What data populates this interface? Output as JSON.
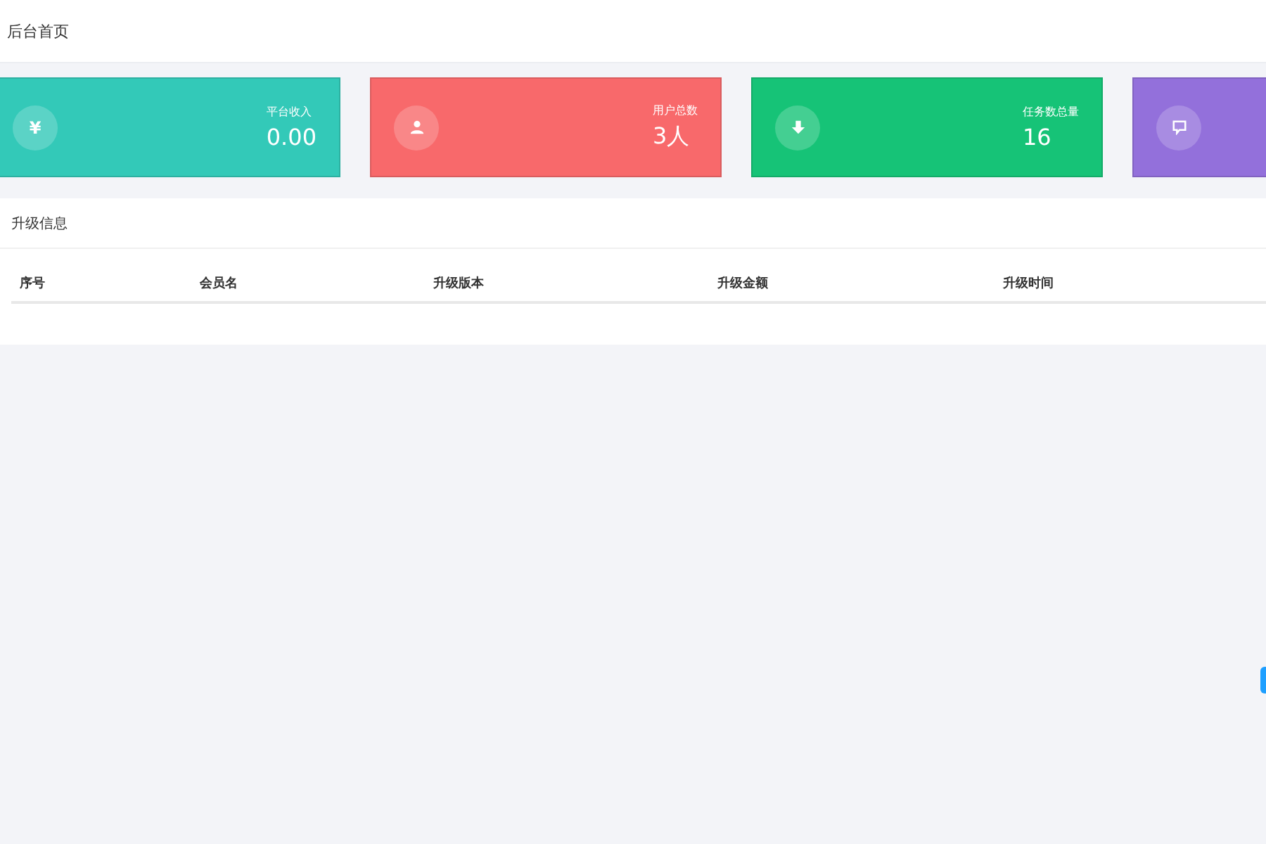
{
  "header": {
    "title": "后台首页"
  },
  "stat_cards": [
    {
      "glyph": "¥",
      "color": "#33c9b8",
      "label": "平台收入",
      "value": "0.00"
    },
    {
      "color": "#f8696b",
      "label": "用户总数",
      "value": "3人"
    },
    {
      "color": "#16c377",
      "label": "任务数总量",
      "value": "16"
    },
    {
      "color": "#9370db"
    }
  ],
  "upgrade_panel": {
    "title": "升级信息",
    "table": {
      "columns": [
        "序号",
        "会员名",
        "升级版本",
        "升级金额",
        "升级时间"
      ]
    }
  }
}
